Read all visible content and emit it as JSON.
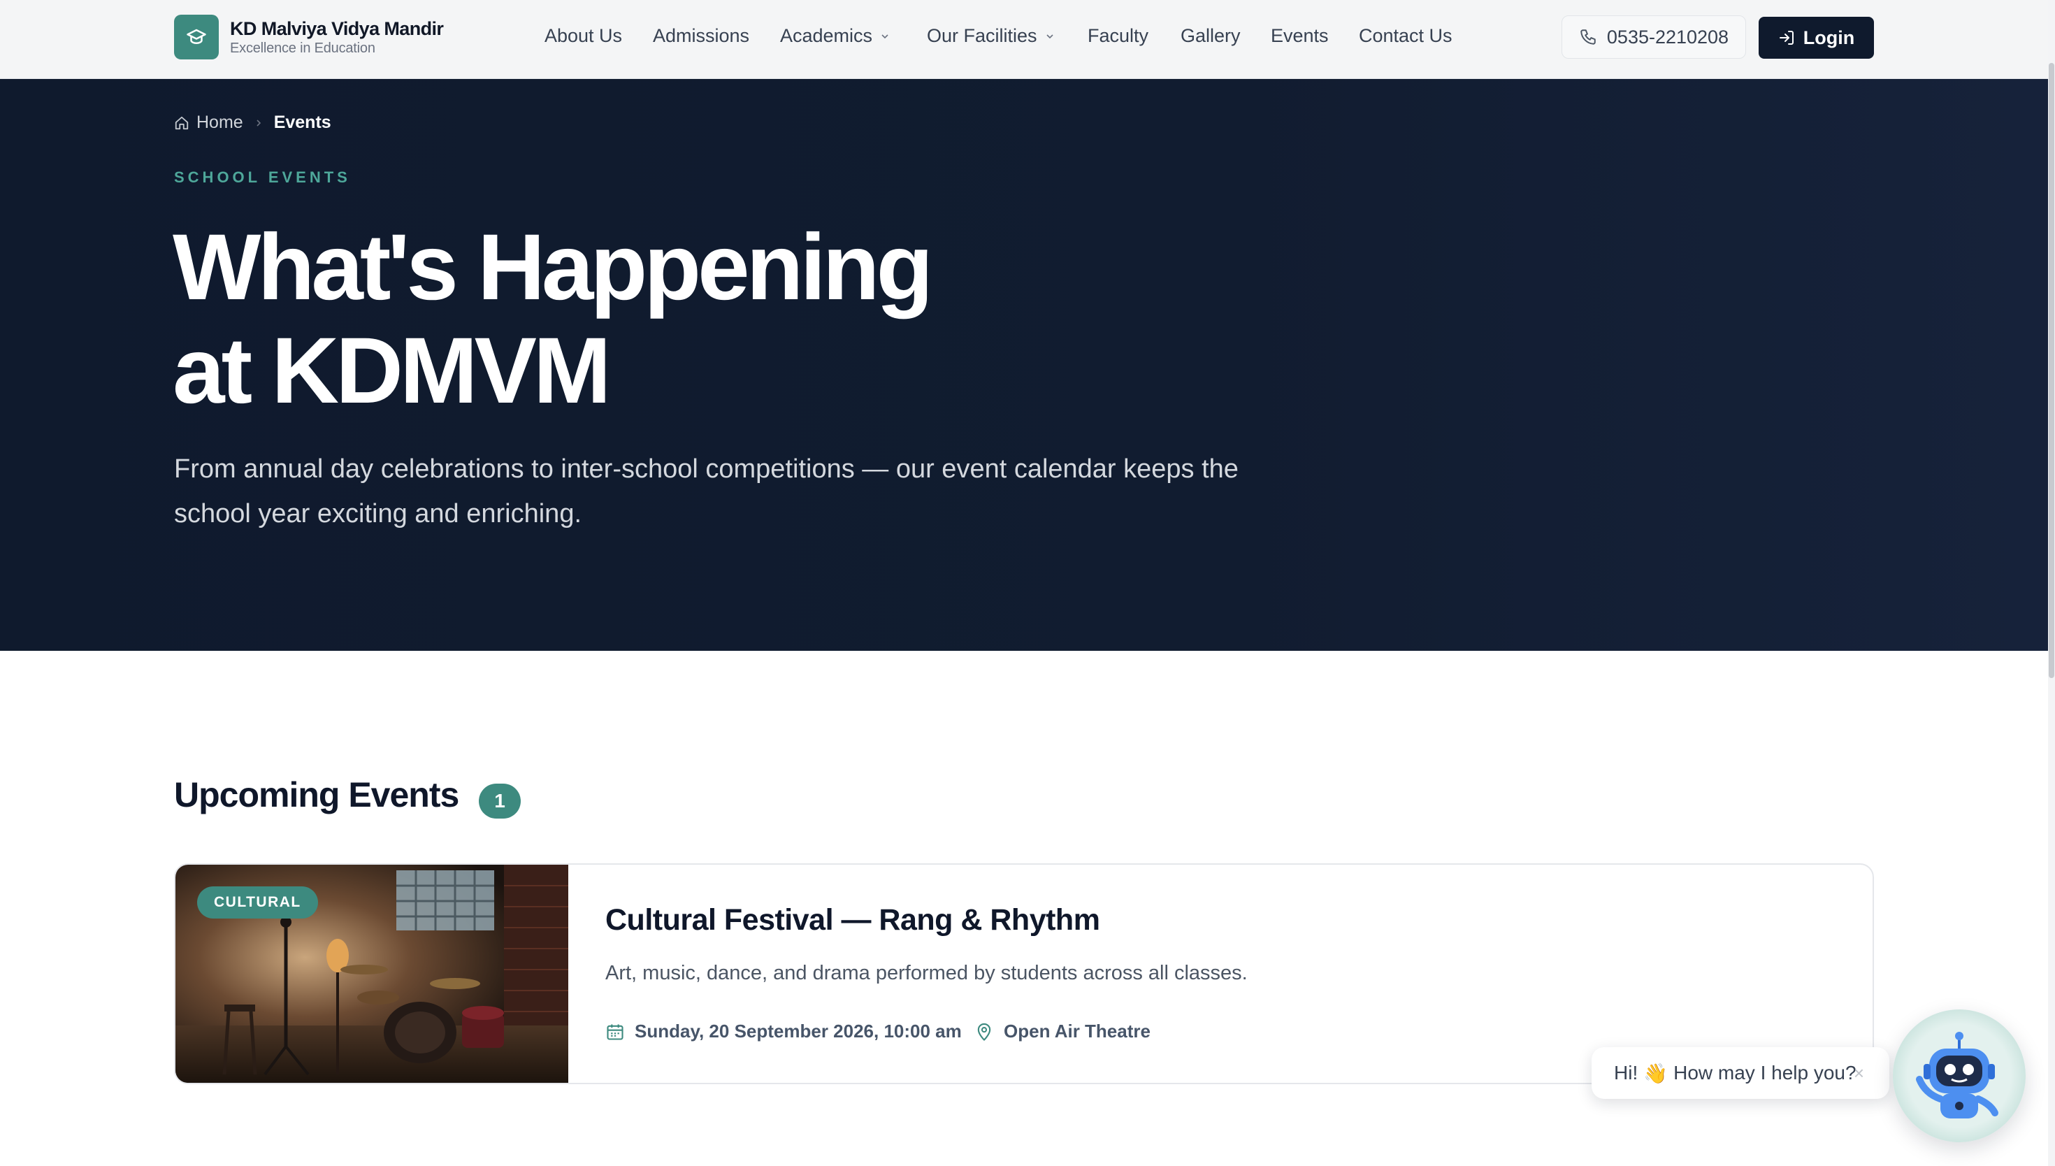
{
  "brand": {
    "name": "KD Malviya Vidya Mandir",
    "tagline": "Excellence in Education"
  },
  "nav": {
    "links": [
      {
        "label": "About Us"
      },
      {
        "label": "Admissions"
      },
      {
        "label": "Academics"
      },
      {
        "label": "Our Facilities"
      },
      {
        "label": "Faculty"
      },
      {
        "label": "Gallery"
      },
      {
        "label": "Events"
      },
      {
        "label": "Contact Us"
      }
    ],
    "phone": "0535-2210208",
    "login_label": "Login"
  },
  "breadcrumb": {
    "home": "Home",
    "current": "Events"
  },
  "hero": {
    "eyebrow": "SCHOOL EVENTS",
    "title_line1": "What's Happening",
    "title_line2": "at KDMVM",
    "subtitle": "From annual day celebrations to inter-school competitions — our event calendar keeps the school year exciting and enriching."
  },
  "upcoming": {
    "title": "Upcoming Events",
    "count": "1",
    "events": [
      {
        "category": "CULTURAL",
        "title": "Cultural Festival — Rang & Rhythm",
        "description": "Art, music, dance, and drama performed by students across all classes.",
        "date": "Sunday, 20 September 2026, 10:00 am",
        "venue": "Open Air Theatre"
      }
    ]
  },
  "chat": {
    "greeting": "Hi!",
    "wave": "👋",
    "message": "How may I help you?",
    "close": "×"
  },
  "colors": {
    "accent": "#3d8a7f",
    "navy": "#0f1a2d",
    "eyebrow": "#4ea79a"
  }
}
